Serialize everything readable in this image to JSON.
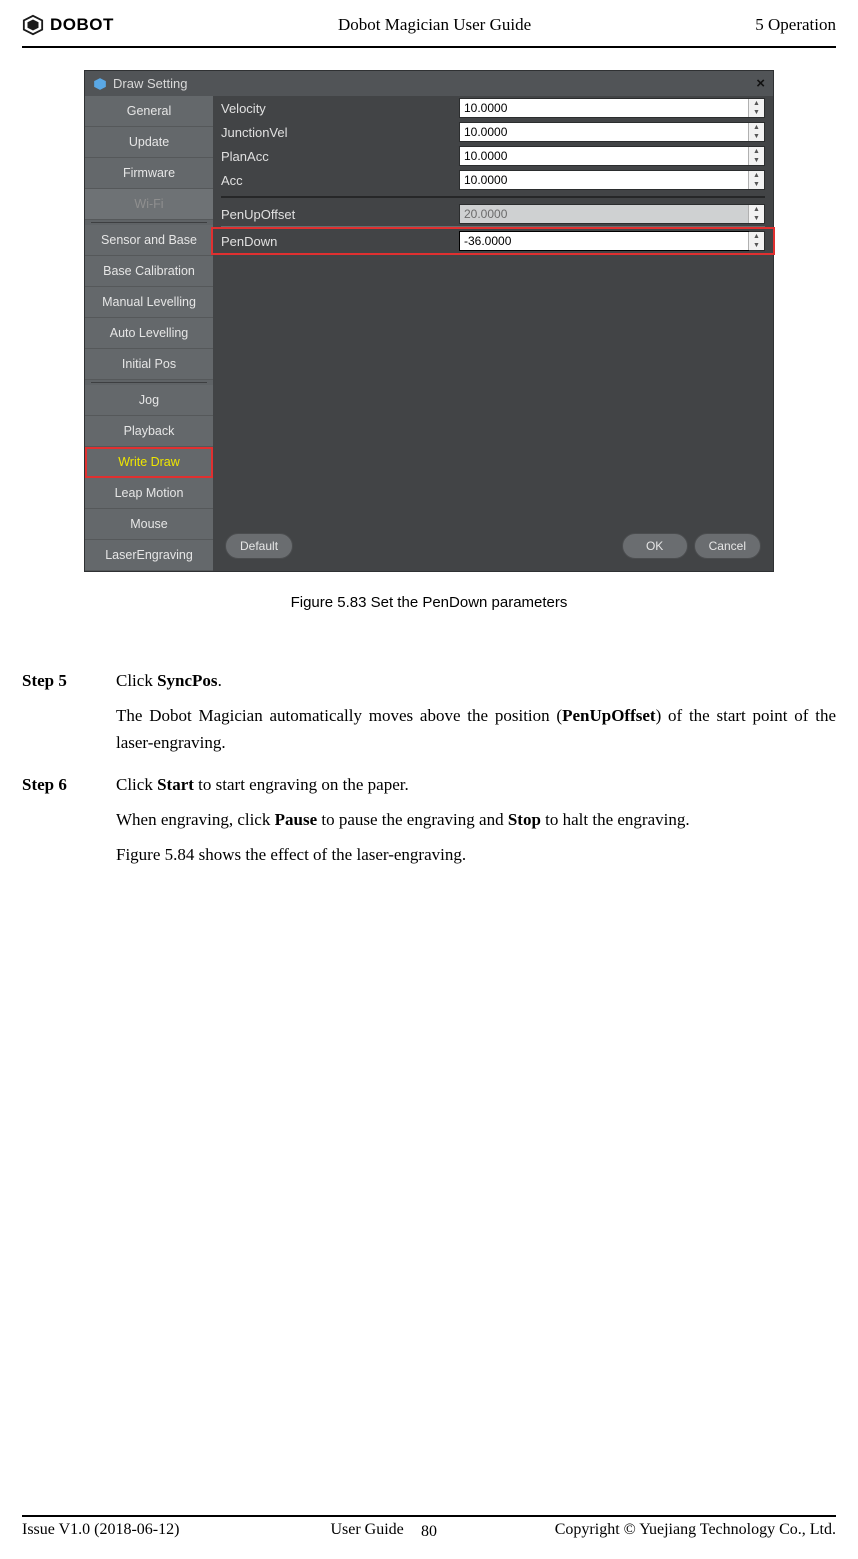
{
  "header": {
    "logo_text": "DOBOT",
    "center": "Dobot Magician User Guide",
    "right": "5 Operation"
  },
  "dialog": {
    "title": "Draw Setting",
    "close": "×",
    "sidebar": {
      "items": [
        {
          "label": "General"
        },
        {
          "label": "Update"
        },
        {
          "label": "Firmware"
        },
        {
          "label": "Wi-Fi",
          "state": "selected"
        },
        {
          "label": "Sensor and Base"
        },
        {
          "label": "Base Calibration"
        },
        {
          "label": "Manual Levelling"
        },
        {
          "label": "Auto Levelling"
        },
        {
          "label": "Initial Pos"
        },
        {
          "label": "Jog"
        },
        {
          "label": "Playback"
        },
        {
          "label": "Write  Draw",
          "state": "write-draw"
        },
        {
          "label": "Leap Motion"
        },
        {
          "label": "Mouse"
        },
        {
          "label": "LaserEngraving"
        }
      ]
    },
    "params_top": [
      {
        "label": "Velocity",
        "value": "10.0000"
      },
      {
        "label": "JunctionVel",
        "value": "10.0000"
      },
      {
        "label": "PlanAcc",
        "value": "10.0000"
      },
      {
        "label": "Acc",
        "value": "10.0000"
      }
    ],
    "param_penup": {
      "label": "PenUpOffset",
      "value": "20.0000"
    },
    "param_pendown": {
      "label": "PenDown",
      "value": "-36.0000"
    },
    "buttons": {
      "default": "Default",
      "ok": "OK",
      "cancel": "Cancel"
    }
  },
  "caption": "Figure 5.83    Set the PenDown parameters",
  "steps": {
    "s5": {
      "label": "Step 5",
      "line1_pre": "Click ",
      "line1_b": "SyncPos",
      "line1_post": ".",
      "p2_pre": "The Dobot Magician automatically moves above the position (",
      "p2_b": "PenUpOffset",
      "p2_post": ") of the start point of the laser-engraving."
    },
    "s6": {
      "label": "Step 6",
      "line1_pre": "Click ",
      "line1_b": "Start",
      "line1_post": " to start engraving on the paper.",
      "p2_a": "When  engraving,  click  ",
      "p2_b1": "Pause",
      "p2_mid": "  to  pause  the  engraving  and  ",
      "p2_b2": "Stop",
      "p2_end": "  to  halt  the engraving.",
      "p3": "Figure 5.84 shows the effect of the laser-engraving."
    }
  },
  "footer": {
    "left": "Issue V1.0 (2018-06-12)",
    "center": "User Guide",
    "right": "Copyright © Yuejiang Technology Co., Ltd.",
    "page": "80"
  }
}
